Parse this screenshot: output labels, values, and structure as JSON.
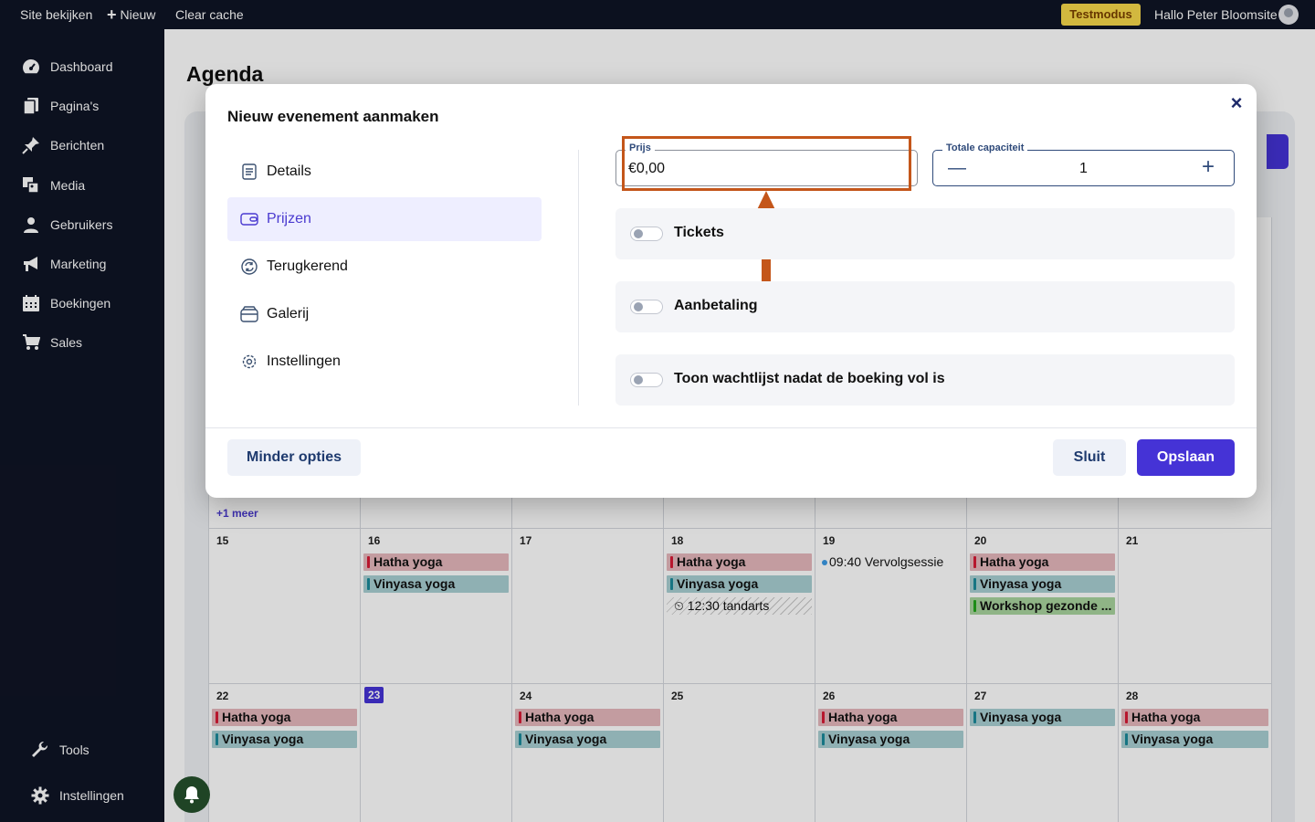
{
  "topbar": {
    "view_site": "Site bekijken",
    "new": "Nieuw",
    "clear_cache": "Clear cache",
    "test_mode": "Testmodus",
    "greeting": "Hallo Peter Bloomsite"
  },
  "sidebar": {
    "items": [
      {
        "label": "Dashboard",
        "icon": "dashboard-icon"
      },
      {
        "label": "Pagina's",
        "icon": "pages-icon"
      },
      {
        "label": "Berichten",
        "icon": "pin-icon"
      },
      {
        "label": "Media",
        "icon": "media-icon"
      },
      {
        "label": "Gebruikers",
        "icon": "user-icon"
      },
      {
        "label": "Marketing",
        "icon": "megaphone-icon"
      },
      {
        "label": "Boekingen",
        "icon": "calendar-icon"
      },
      {
        "label": "Sales",
        "icon": "cart-icon"
      }
    ],
    "tools": "Tools",
    "settings": "Instellingen"
  },
  "page": {
    "title": "Agenda"
  },
  "calendar": {
    "more_link": "+1 meer",
    "days": {
      "d15": "15",
      "d16": "16",
      "d17": "17",
      "d18": "18",
      "d19": "19",
      "d20": "20",
      "d21": "21",
      "d22": "22",
      "d23": "23",
      "d24": "24",
      "d25": "25",
      "d26": "26",
      "d27": "27",
      "d28": "28"
    },
    "events": {
      "hatha": "Hatha yoga",
      "vinyasa": "Vinyasa yoga",
      "tandarts": "⏲ 12:30 tandarts",
      "vervolg": "09:40 Vervolgsessie",
      "workshop": "Workshop gezonde ..."
    }
  },
  "modal": {
    "title": "Nieuw evenement aanmaken",
    "menu": [
      {
        "label": "Details",
        "icon": "document-icon"
      },
      {
        "label": "Prijzen",
        "icon": "wallet-icon"
      },
      {
        "label": "Terugkerend",
        "icon": "repeat-icon"
      },
      {
        "label": "Galerij",
        "icon": "gallery-icon"
      },
      {
        "label": "Instellingen",
        "icon": "gear-icon"
      }
    ],
    "price_label": "Prijs",
    "price_value": "€0,00",
    "capacity_label": "Totale capaciteit",
    "capacity_value": "1",
    "toggles": [
      {
        "label": "Tickets",
        "on": false
      },
      {
        "label": "Aanbetaling",
        "on": false
      },
      {
        "label": "Toon wachtlijst nadat de boeking vol is",
        "on": false
      }
    ],
    "less_options": "Minder opties",
    "close": "Sluit",
    "save": "Opslaan"
  },
  "colors": {
    "accent": "#4533d6",
    "highlight": "#c4561a",
    "nav_bg": "#0f1425"
  }
}
